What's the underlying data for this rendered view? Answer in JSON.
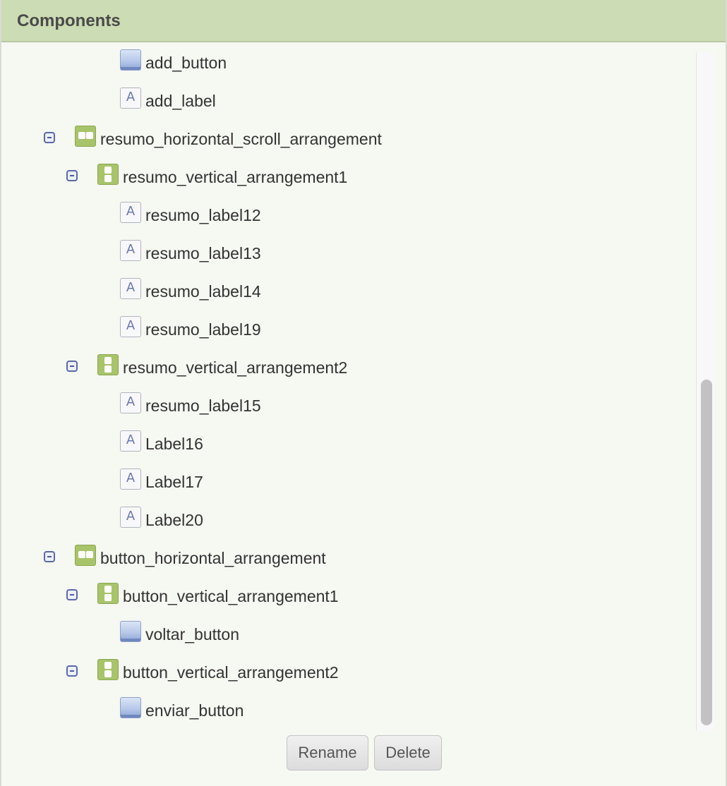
{
  "header": {
    "title": "Components"
  },
  "tree": {
    "items": [
      {
        "label": "add_button",
        "type": "button",
        "depth": 2,
        "toggle": false
      },
      {
        "label": "add_label",
        "type": "label",
        "depth": 2,
        "toggle": false
      },
      {
        "label": "resumo_horizontal_scroll_arrangement",
        "type": "horizontal",
        "depth": 0,
        "toggle": true
      },
      {
        "label": "resumo_vertical_arrangement1",
        "type": "vertical",
        "depth": 1,
        "toggle": true
      },
      {
        "label": "resumo_label12",
        "type": "label",
        "depth": 2,
        "toggle": false
      },
      {
        "label": "resumo_label13",
        "type": "label",
        "depth": 2,
        "toggle": false
      },
      {
        "label": "resumo_label14",
        "type": "label",
        "depth": 2,
        "toggle": false
      },
      {
        "label": "resumo_label19",
        "type": "label",
        "depth": 2,
        "toggle": false
      },
      {
        "label": "resumo_vertical_arrangement2",
        "type": "vertical",
        "depth": 1,
        "toggle": true
      },
      {
        "label": "resumo_label15",
        "type": "label",
        "depth": 2,
        "toggle": false
      },
      {
        "label": "Label16",
        "type": "label",
        "depth": 2,
        "toggle": false
      },
      {
        "label": "Label17",
        "type": "label",
        "depth": 2,
        "toggle": false
      },
      {
        "label": "Label20",
        "type": "label",
        "depth": 2,
        "toggle": false
      },
      {
        "label": "button_horizontal_arrangement",
        "type": "horizontal",
        "depth": 0,
        "toggle": true
      },
      {
        "label": "button_vertical_arrangement1",
        "type": "vertical",
        "depth": 1,
        "toggle": true
      },
      {
        "label": "voltar_button",
        "type": "button",
        "depth": 2,
        "toggle": false
      },
      {
        "label": "button_vertical_arrangement2",
        "type": "vertical",
        "depth": 1,
        "toggle": true
      },
      {
        "label": "enviar_button",
        "type": "button",
        "depth": 2,
        "toggle": false
      }
    ],
    "label_glyph": "A"
  },
  "actions": {
    "rename_label": "Rename",
    "delete_label": "Delete"
  },
  "colors": {
    "header_bg": "#ccdcb4",
    "panel_bg": "#f6f8f2",
    "arrangement_green": "#a8c46a",
    "toggle_blue": "#5a6aa8"
  }
}
